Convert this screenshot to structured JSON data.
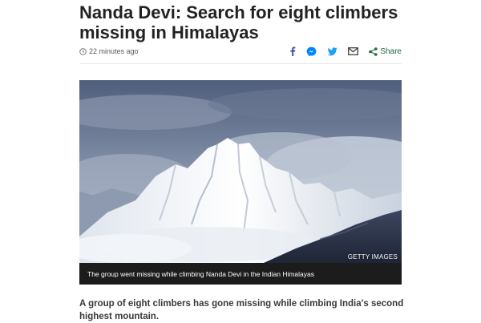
{
  "article": {
    "headline": "Nanda Devi: Search for eight climbers missing in Himalayas",
    "timestamp": "22 minutes ago",
    "intro": "A group of eight climbers has gone missing while climbing India's second highest mountain."
  },
  "share": {
    "label": "Share",
    "icons": [
      "facebook-icon",
      "messenger-icon",
      "twitter-icon",
      "email-icon",
      "share-icon"
    ]
  },
  "image": {
    "credit": "GETTY IMAGES",
    "caption": "The group went missing while climbing Nanda Devi in the Indian Himalayas"
  },
  "colors": {
    "facebook": "#3b5998",
    "messenger": "#0084ff",
    "twitter": "#1da1f2",
    "email": "#404040",
    "share": "#1e6e3a"
  }
}
